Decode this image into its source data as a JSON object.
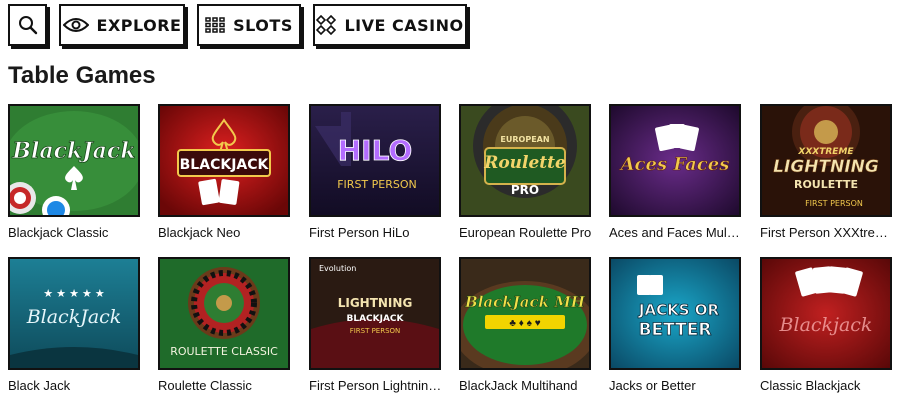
{
  "nav": {
    "search_icon": "search-icon",
    "explore": {
      "label": "EXPLORE",
      "icon": "eye-icon"
    },
    "slots": {
      "label": "SLOTS",
      "icon": "grid-icon"
    },
    "live_casino": {
      "label": "LIVE CASINO",
      "icon": "chip-icon"
    }
  },
  "section": {
    "title": "Table Games"
  },
  "games": [
    {
      "name": "Blackjack Classic",
      "art": "BlackJack"
    },
    {
      "name": "Blackjack Neo",
      "art": "BLACKJACK"
    },
    {
      "name": "First Person HiLo",
      "art": "HILO",
      "art_sub": "FIRST PERSON"
    },
    {
      "name": "European Roulette Pro",
      "art": "Roulette",
      "art_top": "EUROPEAN",
      "art_sub": "PRO"
    },
    {
      "name": "Aces and Faces Multi-...",
      "art": "Aces Faces"
    },
    {
      "name": "First Person XXXtrem...",
      "art": "LIGHTNING",
      "art_top": "XXXTREME",
      "art_sub": "ROULETTE",
      "art_foot": "FIRST PERSON"
    },
    {
      "name": "Black Jack",
      "art": "BlackJack"
    },
    {
      "name": "Roulette Classic",
      "art": "ROULETTE CLASSIC"
    },
    {
      "name": "First Person Lightning ...",
      "art": "LIGHTNING",
      "art_top": "Evolution",
      "art_sub": "BLACKJACK",
      "art_foot": "FIRST PERSON"
    },
    {
      "name": "BlackJack Multihand",
      "art": "BlackJack MH"
    },
    {
      "name": "Jacks or Better",
      "art": "JACKS OR",
      "art_sub": "BETTER"
    },
    {
      "name": "Classic Blackjack",
      "art": "Blackjack"
    }
  ]
}
